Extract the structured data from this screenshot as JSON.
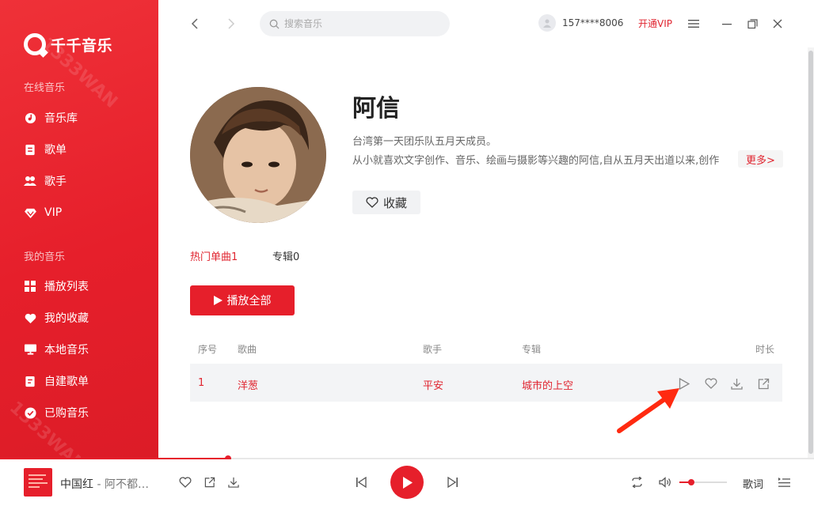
{
  "sidebar": {
    "logo_text": "千千音乐",
    "watermark": "1333WAN",
    "online_section": "在线音乐",
    "online_items": [
      {
        "label": "音乐库",
        "icon": "music-library-icon"
      },
      {
        "label": "歌单",
        "icon": "playlist-icon"
      },
      {
        "label": "歌手",
        "icon": "singer-icon"
      },
      {
        "label": "VIP",
        "icon": "vip-diamond-icon"
      }
    ],
    "my_section": "我的音乐",
    "my_items": [
      {
        "label": "播放列表",
        "icon": "grid-icon"
      },
      {
        "label": "我的收藏",
        "icon": "heart-icon"
      },
      {
        "label": "本地音乐",
        "icon": "monitor-icon"
      },
      {
        "label": "自建歌单",
        "icon": "custom-playlist-icon"
      },
      {
        "label": "已购音乐",
        "icon": "purchased-check-icon"
      }
    ]
  },
  "topbar": {
    "search_placeholder": "搜索音乐",
    "phone": "157****8006",
    "vip_label": "开通VIP"
  },
  "artist": {
    "name": "阿信",
    "desc_line1": "台湾第一天团乐队五月天成员。",
    "desc_line2": "从小就喜欢文字创作、音乐、绘画与摄影等兴趣的阿信,自从五月天出道以来,创作",
    "more_label": "更多>",
    "favorite_label": "收藏"
  },
  "tabs": {
    "hot_songs": "热门单曲1",
    "albums": "专辑0"
  },
  "play_all_label": "播放全部",
  "table": {
    "headers": {
      "index": "序号",
      "song": "歌曲",
      "singer": "歌手",
      "album": "专辑",
      "duration": "时长"
    },
    "rows": [
      {
        "index": "1",
        "song": "洋葱",
        "singer": "平安",
        "album": "城市的上空"
      }
    ]
  },
  "player": {
    "title": "中国红",
    "separator": " - ",
    "artist": "阿不都…",
    "progress": 0.28,
    "volume": 0.25,
    "lyrics_label": "歌词"
  },
  "colors": {
    "accent": "#e61f2b",
    "accent_text": "#e02530",
    "arrow": "#ff2a10"
  }
}
